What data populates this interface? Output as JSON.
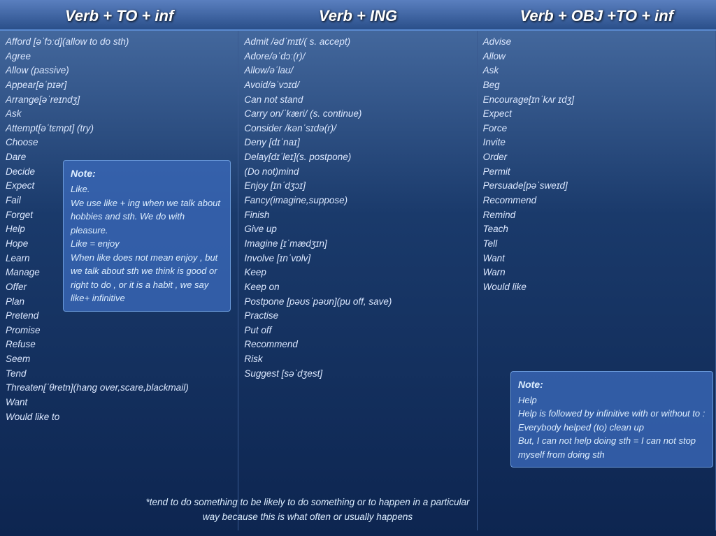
{
  "headers": {
    "col1": "Verb + TO + inf",
    "col2": "Verb + ING",
    "col3": "Verb + OBJ +TO + inf"
  },
  "col1_words": [
    "Afford [əˈfɔːd](allow to do sth)",
    "Agree",
    "Allow (passive)",
    "Appear[əˈpɪər]",
    "Arrange[əˈreɪndʒ]",
    "Ask",
    "Attempt[əˈtɛmpt] (try)",
    "Choose",
    "Dare",
    "Decide",
    "Expect",
    "Fail",
    "Forget",
    "Help",
    "Hope",
    "Learn",
    "Manage",
    "Offer",
    "Plan",
    "Pretend",
    "Promise",
    "Refuse",
    "Seem",
    "Tend",
    "Threaten[ˈθretn](hang over,scare,blackmail)",
    "Want",
    "Would like to"
  ],
  "col2_words": [
    "Admit /ədˈmɪt/( s. accept)",
    "Adore/əˈdɔː(r)/",
    "Allow/əˈlaʊ/",
    "Avoid/əˈvɔɪd/",
    "Can not stand",
    "Carry on/ˈkæri/ (s. continue)",
    "Consider /kənˈsɪdə(r)/",
    "Deny [dɪˈnaɪ]",
    "Delay[dɪˈleɪ](s. postpone)",
    "(Do not)mind",
    "Enjoy [ɪnˈdʒɔɪ]",
    "Fancy(imagine,suppose)",
    "Finish",
    "Give up",
    "Imagine [ɪˈmædʒɪn]",
    "Involve [ɪnˈvɒlv]",
    "Keep",
    "Keep on",
    "Postpone [pəʊsˈpəʊn](pu off, save)",
    "Practise",
    "Put off",
    "Recommend",
    "Risk",
    "Suggest [səˈdʒest]"
  ],
  "col3_words": [
    "Advise",
    "Allow",
    "Ask",
    "Beg",
    "Encourage[ɪnˈkʌr ɪdʒ]",
    "Expect",
    "Force",
    "Invite",
    "Order",
    "Permit",
    "Persuade[pəˈsweɪd]",
    "Recommend",
    "Remind",
    "Teach",
    "Tell",
    "Want",
    "Warn",
    "Would like"
  ],
  "note_left": {
    "title": "Note:",
    "line1": "Like.",
    "line2": "We use like + ing when we talk about hobbies and sth. We do with pleasure.",
    "line3": "Like = enjoy",
    "line4": "When like does not mean enjoy , but we talk about sth we think is good or right to do , or it is a habit , we say like+ infinitive"
  },
  "note_right": {
    "title": "Note:",
    "line1": "Help",
    "line2": "Help is followed by infinitive with or without to : Everybody helped (to) clean up",
    "line3": "But, I can not help doing sth = I can not stop myself from doing sth"
  },
  "footer": {
    "text": "*tend to do something to be likely to do something or to happen in a particular way because this is what often or usually happens"
  }
}
